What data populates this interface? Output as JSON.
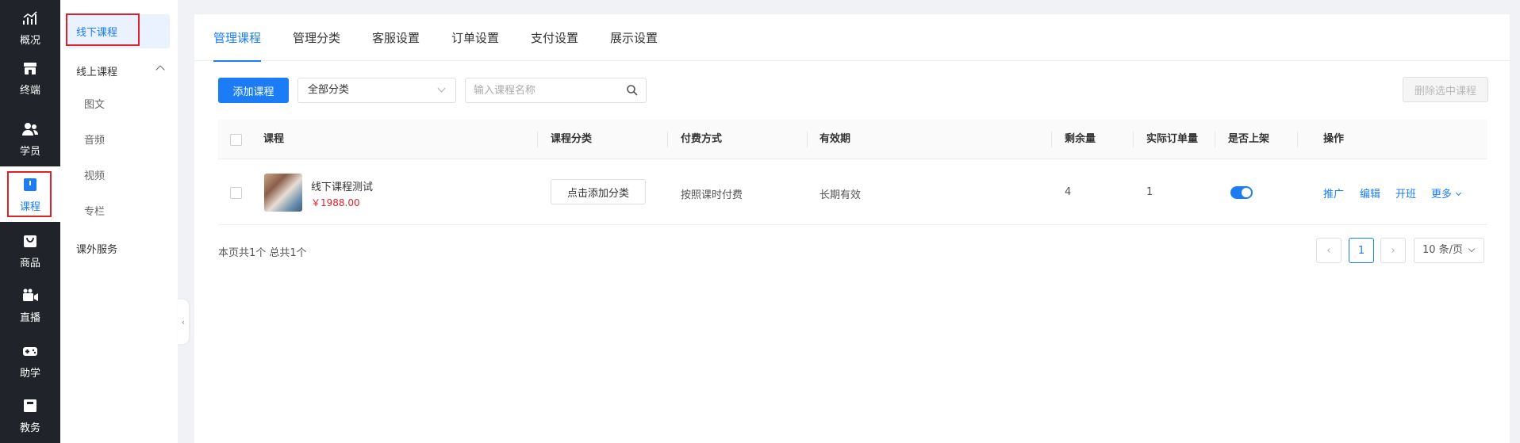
{
  "nav": {
    "items": [
      {
        "label": "概况",
        "icon": "chart-icon"
      },
      {
        "label": "终端",
        "icon": "store-icon"
      },
      {
        "label": "学员",
        "icon": "users-icon"
      },
      {
        "label": "课程",
        "icon": "book-icon"
      },
      {
        "label": "商品",
        "icon": "bag-icon"
      },
      {
        "label": "直播",
        "icon": "video-icon"
      },
      {
        "label": "助学",
        "icon": "gamepad-icon"
      },
      {
        "label": "教务",
        "icon": "notebook-icon"
      }
    ]
  },
  "subnav": {
    "offline": "线下课程",
    "online": "线上课程",
    "children": [
      "图文",
      "音频",
      "视频",
      "专栏"
    ],
    "extra": "课外服务"
  },
  "tabs": [
    "管理课程",
    "管理分类",
    "客服设置",
    "订单设置",
    "支付设置",
    "展示设置"
  ],
  "toolbar": {
    "add_label": "添加课程",
    "category_value": "全部分类",
    "search_placeholder": "输入课程名称",
    "delete_label": "删除选中课程"
  },
  "table": {
    "headers": [
      "课程",
      "课程分类",
      "付费方式",
      "有效期",
      "剩余量",
      "实际订单量",
      "是否上架",
      "操作"
    ],
    "rows": [
      {
        "name": "线下课程测试",
        "price": "￥1988.00",
        "category_button": "点击添加分类",
        "payment": "按照课时付费",
        "validity": "长期有效",
        "remaining": "4",
        "orders": "1",
        "actions": [
          "推广",
          "编辑",
          "开班",
          "更多"
        ]
      }
    ]
  },
  "footer": {
    "summary": "本页共1个 总共1个",
    "current_page": "1",
    "page_size": "10 条/页"
  },
  "colors": {
    "accent": "#1b7cf5",
    "price": "#e0212c",
    "nav_bg": "#20232a",
    "highlight": "#e0212c"
  }
}
